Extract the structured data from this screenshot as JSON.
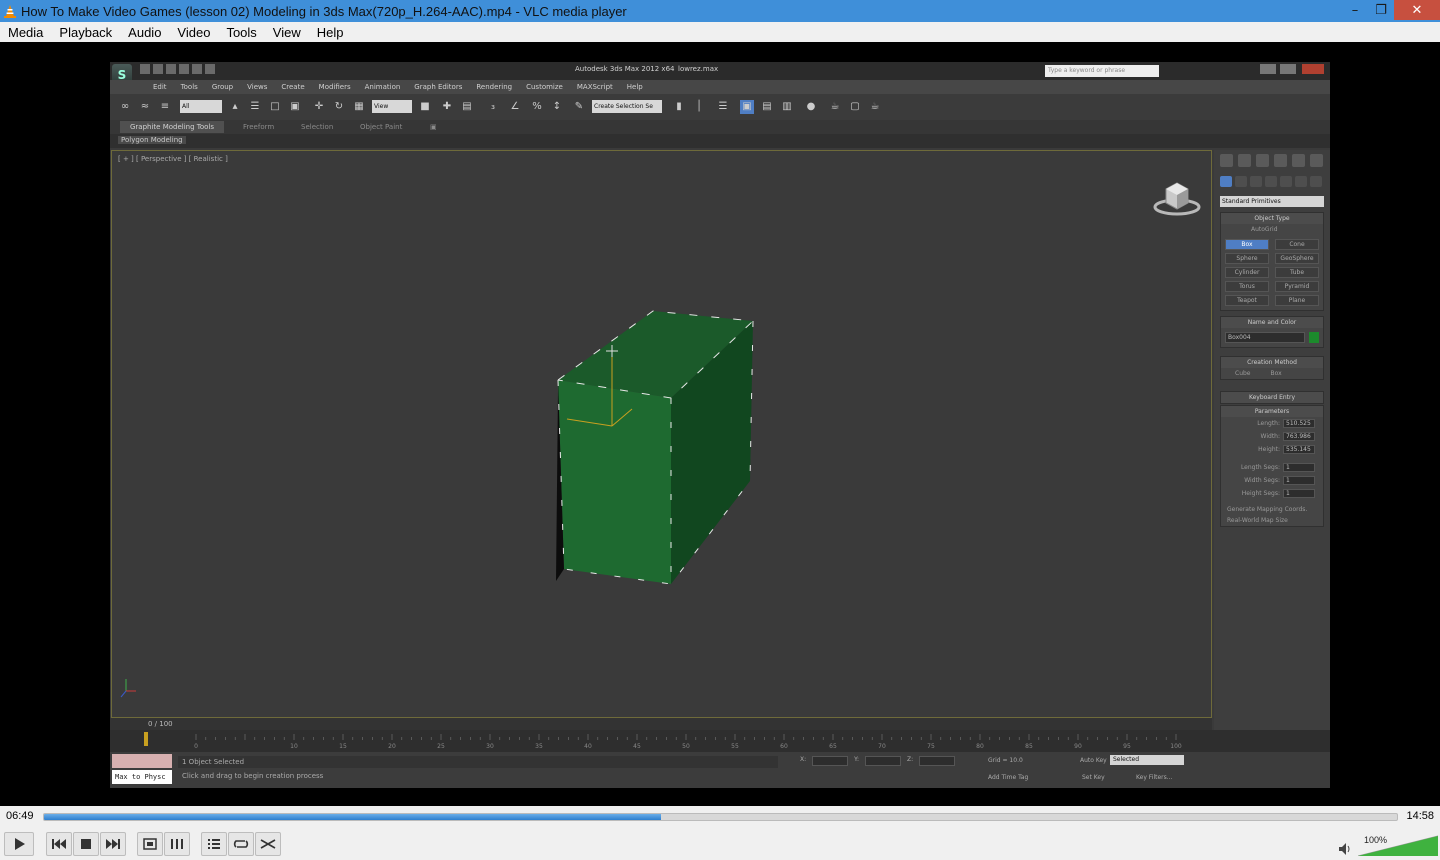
{
  "window": {
    "title": "How To Make Video Games (lesson 02) Modeling in 3ds Max(720p_H.264-AAC).mp4 - VLC media player"
  },
  "menu": [
    "Media",
    "Playback",
    "Audio",
    "Video",
    "Tools",
    "View",
    "Help"
  ],
  "max": {
    "app_title": "Autodesk 3ds Max 2012 x64",
    "file": "lowrez.max",
    "search_placeholder": "Type a keyword or phrase",
    "menu": [
      "Edit",
      "Tools",
      "Group",
      "Views",
      "Create",
      "Modifiers",
      "Animation",
      "Graph Editors",
      "Rendering",
      "Customize",
      "MAXScript",
      "Help"
    ],
    "selection_filter": "All",
    "ref_coord": "View",
    "named_sel": "Create Selection Se",
    "ribbon_tabs": [
      "Graphite Modeling Tools",
      "Freeform",
      "Selection",
      "Object Paint"
    ],
    "ribbon_panel": "Polygon Modeling",
    "viewport_label": "[ + ] [ Perspective ] [ Realistic ]",
    "command_panel": {
      "category": "Standard Primitives",
      "object_type_title": "Object Type",
      "autogrid": "AutoGrid",
      "primitives": [
        "Box",
        "Cone",
        "Sphere",
        "GeoSphere",
        "Cylinder",
        "Tube",
        "Torus",
        "Pyramid",
        "Teapot",
        "Plane"
      ],
      "name_color_title": "Name and Color",
      "object_name": "Box004",
      "object_color": "#1c8a2c",
      "creation_method_title": "Creation Method",
      "method_cube": "Cube",
      "method_box": "Box",
      "keyboard_entry": "Keyboard Entry",
      "parameters_title": "Parameters",
      "params": [
        {
          "label": "Length:",
          "value": "510.525"
        },
        {
          "label": "Width:",
          "value": "763.986"
        },
        {
          "label": "Height:",
          "value": "535.145"
        }
      ],
      "segs": [
        {
          "label": "Length Segs:",
          "value": "1"
        },
        {
          "label": "Width Segs:",
          "value": "1"
        },
        {
          "label": "Height Segs:",
          "value": "1"
        }
      ],
      "gen_mapping": "Generate Mapping Coords.",
      "real_world": "Real-World Map Size"
    },
    "timeline": "0 / 100",
    "ticks": [
      "0",
      "10",
      "15",
      "20",
      "25",
      "30",
      "35",
      "40",
      "45",
      "50",
      "55",
      "60",
      "65",
      "70",
      "75",
      "80",
      "85",
      "90",
      "95",
      "100"
    ],
    "status": {
      "selected": "1 Object Selected",
      "prompt": "Click and drag to begin creation process",
      "maxscript": "Max to Physc",
      "x_label": "X:",
      "y_label": "Y:",
      "z_label": "Z:",
      "grid": "Grid = 10.0",
      "add_time_tag": "Add Time Tag",
      "auto_key": "Auto Key",
      "set_key": "Set Key",
      "key_mode": "Selected",
      "key_filters": "Key Filters...",
      "frame": "0"
    }
  },
  "player": {
    "elapsed": "06:49",
    "total": "14:58",
    "progress": 0.456,
    "volume_label": "100%",
    "volume": 1.0
  }
}
